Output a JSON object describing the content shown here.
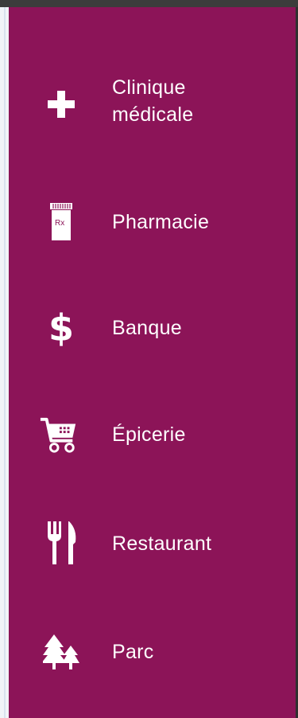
{
  "services": [
    {
      "label_line1": "Clinique",
      "label_line2": "médicale",
      "icon": "medical-cross-icon"
    },
    {
      "label": "Pharmacie",
      "icon": "pill-bottle-icon",
      "icon_text": "Rx"
    },
    {
      "label": "Banque",
      "icon": "dollar-icon",
      "icon_text": "$"
    },
    {
      "label": "Épicerie",
      "icon": "shopping-cart-icon"
    },
    {
      "label": "Restaurant",
      "icon": "fork-knife-icon"
    },
    {
      "label": "Parc",
      "icon": "trees-icon"
    }
  ],
  "colors": {
    "panel": "#8c1458",
    "text": "#ffffff"
  }
}
